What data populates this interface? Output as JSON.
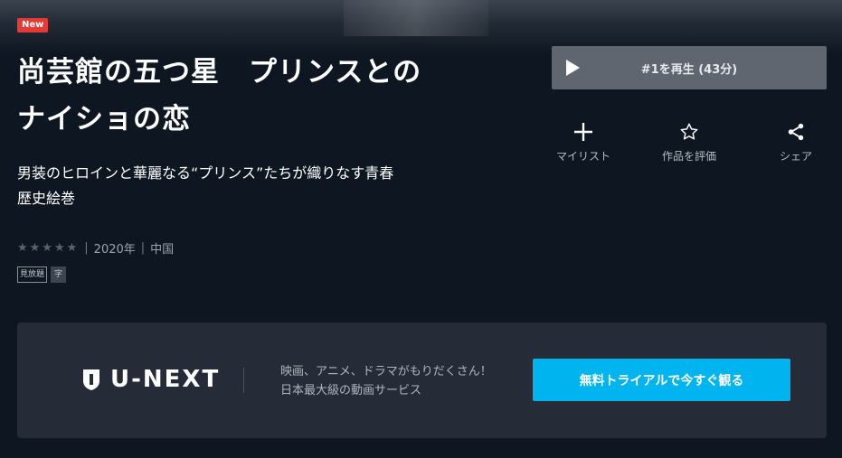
{
  "badge": {
    "new": "New"
  },
  "title": {
    "line1": "尚芸館の五つ星　プリンスとの",
    "line2": "ナイショの恋"
  },
  "catchcopy": {
    "line1": "男装のヒロインと華麗なる“プリンス”たちが織りなす青春",
    "line2": "歴史絵巻"
  },
  "meta": {
    "stars": "★★★★★",
    "year": "2020年",
    "country": "中国",
    "separator": "|"
  },
  "tags": {
    "unlimited": "見放題",
    "subtitle": "字"
  },
  "play": {
    "label": "#1を再生 (43分)",
    "icon": "play-icon"
  },
  "actions": [
    {
      "label": "マイリスト",
      "icon": "plus-icon"
    },
    {
      "label": "作品を評価",
      "icon": "star-outline-icon"
    },
    {
      "label": "シェア",
      "icon": "share-icon"
    }
  ],
  "banner": {
    "logo": "U-NEXT",
    "text_line1": "映画、アニメ、ドラマがもりだくさん！",
    "text_line2": "日本最大級の動画サービス",
    "cta": "無料トライアルで今すぐ観る"
  },
  "colors": {
    "accent": "#00b4ef",
    "badge": "#e53935",
    "background": "#0e1621",
    "banner": "#252c38"
  }
}
